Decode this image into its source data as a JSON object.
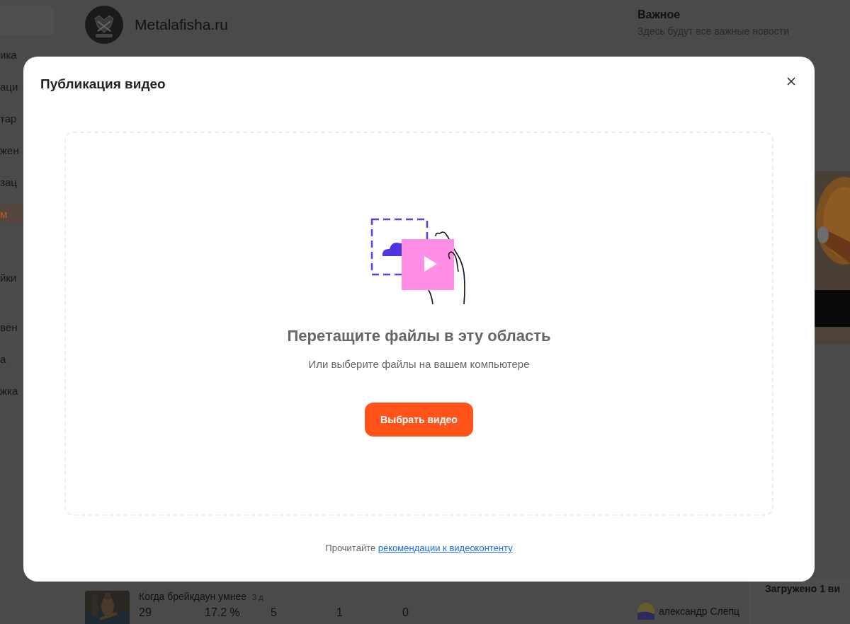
{
  "sidebar": {
    "items": [
      {
        "label": "ика",
        "selected": false
      },
      {
        "label": "аци",
        "selected": false
      },
      {
        "label": "тар",
        "selected": false
      },
      {
        "label": "жен",
        "selected": false
      },
      {
        "label": "зац",
        "selected": false
      },
      {
        "label": "м",
        "selected": true
      },
      {
        "label": "йки",
        "selected": false
      },
      {
        "label": "вен",
        "selected": false
      },
      {
        "label": "а",
        "selected": false
      },
      {
        "label": "жка",
        "selected": false
      }
    ]
  },
  "channel": {
    "name": "Metalafisha.ru"
  },
  "important": {
    "title": "Важное",
    "subtitle": "Здесь будут все важные новости"
  },
  "video_row": {
    "title": "Когда брейкдаун умнее",
    "age": "3 д",
    "stats": [
      "29",
      "17.2 %",
      "5",
      "1",
      "0"
    ],
    "author": "александр Слепц"
  },
  "upload_status": "Загружено 1 ви",
  "modal": {
    "title": "Публикация видео",
    "drop_title": "Перетащите файлы в эту область",
    "drop_hint": "Или выберите файлы на вашем компьютере",
    "button": "Выбрать видео",
    "footer_text": "Прочитайте",
    "footer_link": "рекомендации к видеоконтенту"
  }
}
